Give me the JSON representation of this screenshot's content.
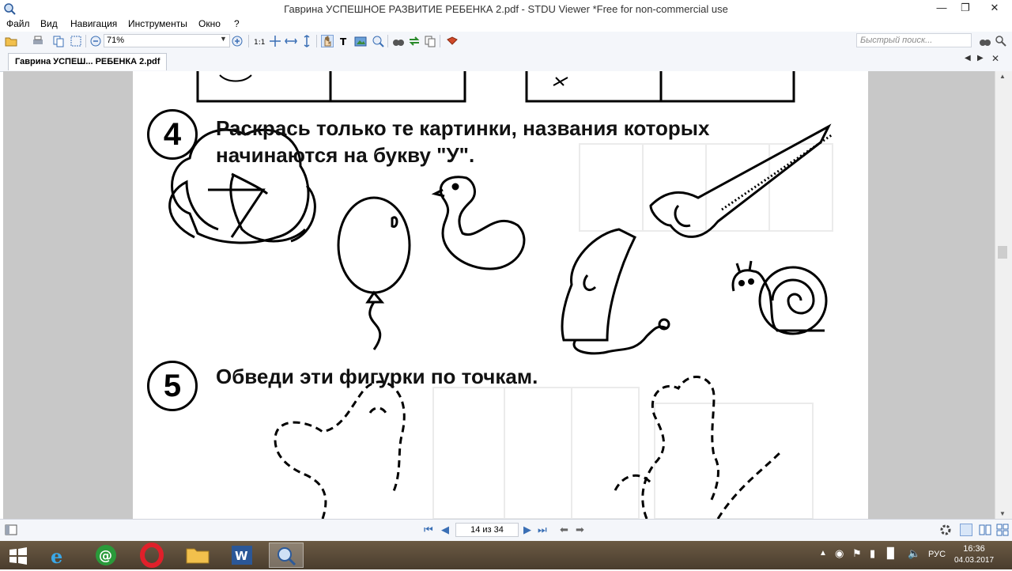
{
  "window": {
    "title": "Гаврина УСПЕШНОЕ РАЗВИТИЕ РЕБЕНКА 2.pdf - STDU Viewer *Free for non-commercial use"
  },
  "menu": [
    "Файл",
    "Вид",
    "Навигация",
    "Инструменты",
    "Окно",
    "?"
  ],
  "toolbar": {
    "zoom": "71%",
    "search_placeholder": "Быстрый поиск..."
  },
  "tab": {
    "label": "Гаврина УСПЕШ... РЕБЕНКА 2.pdf"
  },
  "document": {
    "task4": {
      "number": "4",
      "line1": "Раскрась только те картинки, названия которых",
      "line2": "начинаются на букву \"У\"."
    },
    "task5": {
      "number": "5",
      "line1": "Обведи эти фигурки по точкам."
    }
  },
  "statusbar": {
    "page_indicator": "14 из 34"
  },
  "taskbar": {
    "lang": "РУС",
    "time": "16:36",
    "date": "04.03.2017"
  },
  "colors": {
    "accent": "#3a6fb5",
    "taskbar": "#5a4a38",
    "doc_bg": "#c8c8c8"
  }
}
